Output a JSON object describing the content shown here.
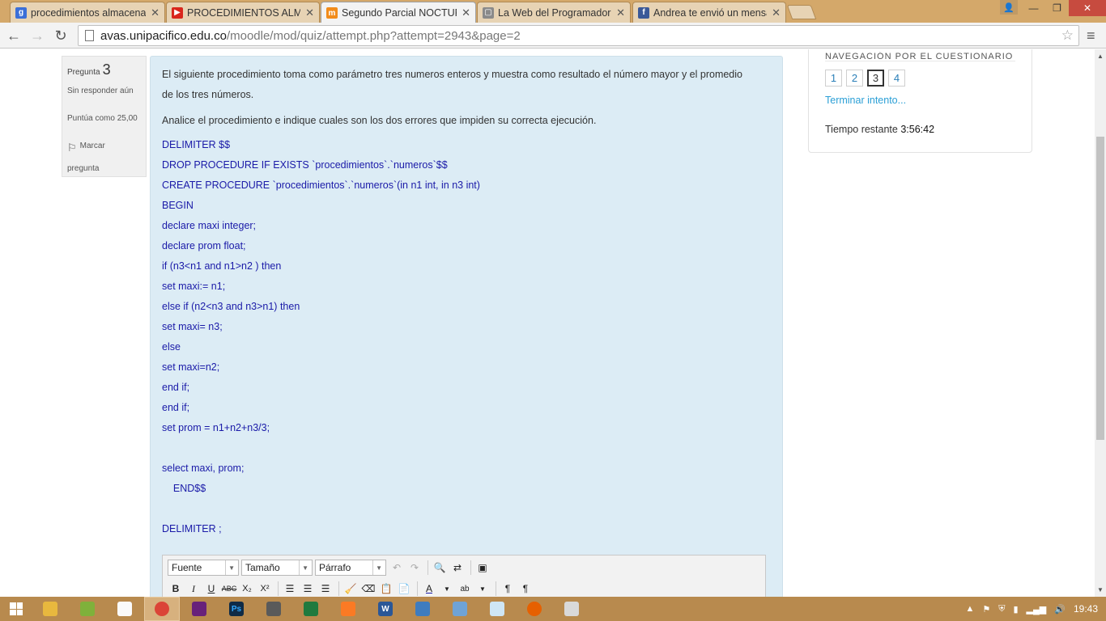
{
  "tabs": [
    {
      "label": "procedimientos almacena",
      "icon": "google-icon",
      "color": "#3b6fd8",
      "glyph": "g"
    },
    {
      "label": "PROCEDIMIENTOS ALMAC",
      "icon": "youtube-icon",
      "color": "#d9261c",
      "glyph": "▶"
    },
    {
      "label": "Segundo Parcial NOCTUR",
      "icon": "moodle-icon",
      "color": "#f28c1b",
      "glyph": "m"
    },
    {
      "label": "La Web del Programador",
      "icon": "page-icon",
      "color": "#8a8a8a",
      "glyph": "▢"
    },
    {
      "label": "Andrea te envió un mensa",
      "icon": "facebook-icon",
      "color": "#3b5998",
      "glyph": "f"
    }
  ],
  "address": {
    "host": "avas.unipacifico.edu.co",
    "path": "/moodle/mod/quiz/attempt.php?attempt=2943&page=2"
  },
  "question_info": {
    "label": "Pregunta",
    "number": "3",
    "status": "Sin responder aún",
    "points": "Puntúa como 25,00",
    "flag_line1": "Marcar",
    "flag_line2": "pregunta"
  },
  "question": {
    "intro": "El siguiente procedimiento toma como parámetro tres numeros enteros y muestra como resultado el número mayor y el promedio de los tres números.",
    "instruction": "Analice el procedimiento e indique cuales son los dos errores que impiden su correcta ejecución.",
    "code": [
      "DELIMITER $$",
      "DROP PROCEDURE IF EXISTS `procedimientos`.`numeros`$$",
      "CREATE PROCEDURE `procedimientos`.`numeros`(in n1 int, in n3 int)",
      "BEGIN",
      "declare maxi integer;",
      "declare prom float;",
      "if (n3<n1 and n1>n2 ) then",
      "set maxi:= n1;",
      "else if (n2<n3 and n3>n1) then",
      "set maxi= n3;",
      "else",
      "set maxi=n2;",
      "end if;",
      "end if;",
      "set prom = n1+n2+n3/3;",
      "",
      "select maxi, prom;",
      "    END$$",
      "",
      "DELIMITER ;"
    ]
  },
  "editor": {
    "font_label": "Fuente",
    "size_label": "Tamaño",
    "format_label": "Párrafo",
    "bold": "B",
    "italic": "I",
    "underline": "U",
    "strike": "ABC",
    "sub": "X₂",
    "sup": "X²"
  },
  "quiz_nav": {
    "title": "NAVEGACIÓN POR EL CUESTIONARIO",
    "pages": [
      "1",
      "2",
      "3",
      "4"
    ],
    "current": "3",
    "finish": "Terminar intento...",
    "time_label": "Tiempo restante",
    "time_value": "3:56:42"
  },
  "taskbar": {
    "clock": "19:43"
  }
}
